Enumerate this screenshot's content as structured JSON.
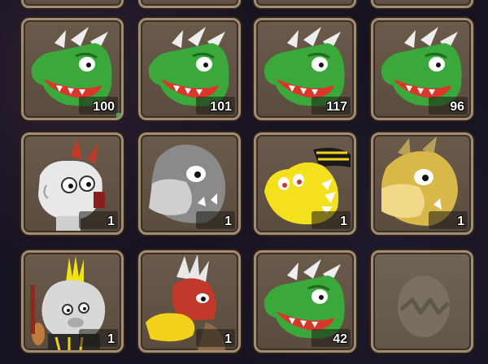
{
  "tiles": [
    {
      "sprite": "green-dragon-icon",
      "count": "100"
    },
    {
      "sprite": "green-dragon-icon",
      "count": "101"
    },
    {
      "sprite": "green-dragon-icon",
      "count": "117"
    },
    {
      "sprite": "green-dragon-icon",
      "count": "96"
    },
    {
      "sprite": "white-spiky-creature-icon",
      "count": "1"
    },
    {
      "sprite": "silver-dragon-icon",
      "count": "1"
    },
    {
      "sprite": "yellow-striped-dragon-icon",
      "count": "1"
    },
    {
      "sprite": "gold-dragon-icon",
      "count": "1"
    },
    {
      "sprite": "mohawk-creature-icon",
      "count": "1"
    },
    {
      "sprite": "red-crested-bird-icon",
      "count": "1"
    },
    {
      "sprite": "green-dragon-icon",
      "count": "42"
    },
    {
      "sprite": "cracked-egg-silhouette-icon",
      "count": ""
    }
  ],
  "colors": {
    "tile_border": "#a38c72",
    "tile_bg": "#5a4c3e",
    "count_text": "#ffffff"
  }
}
